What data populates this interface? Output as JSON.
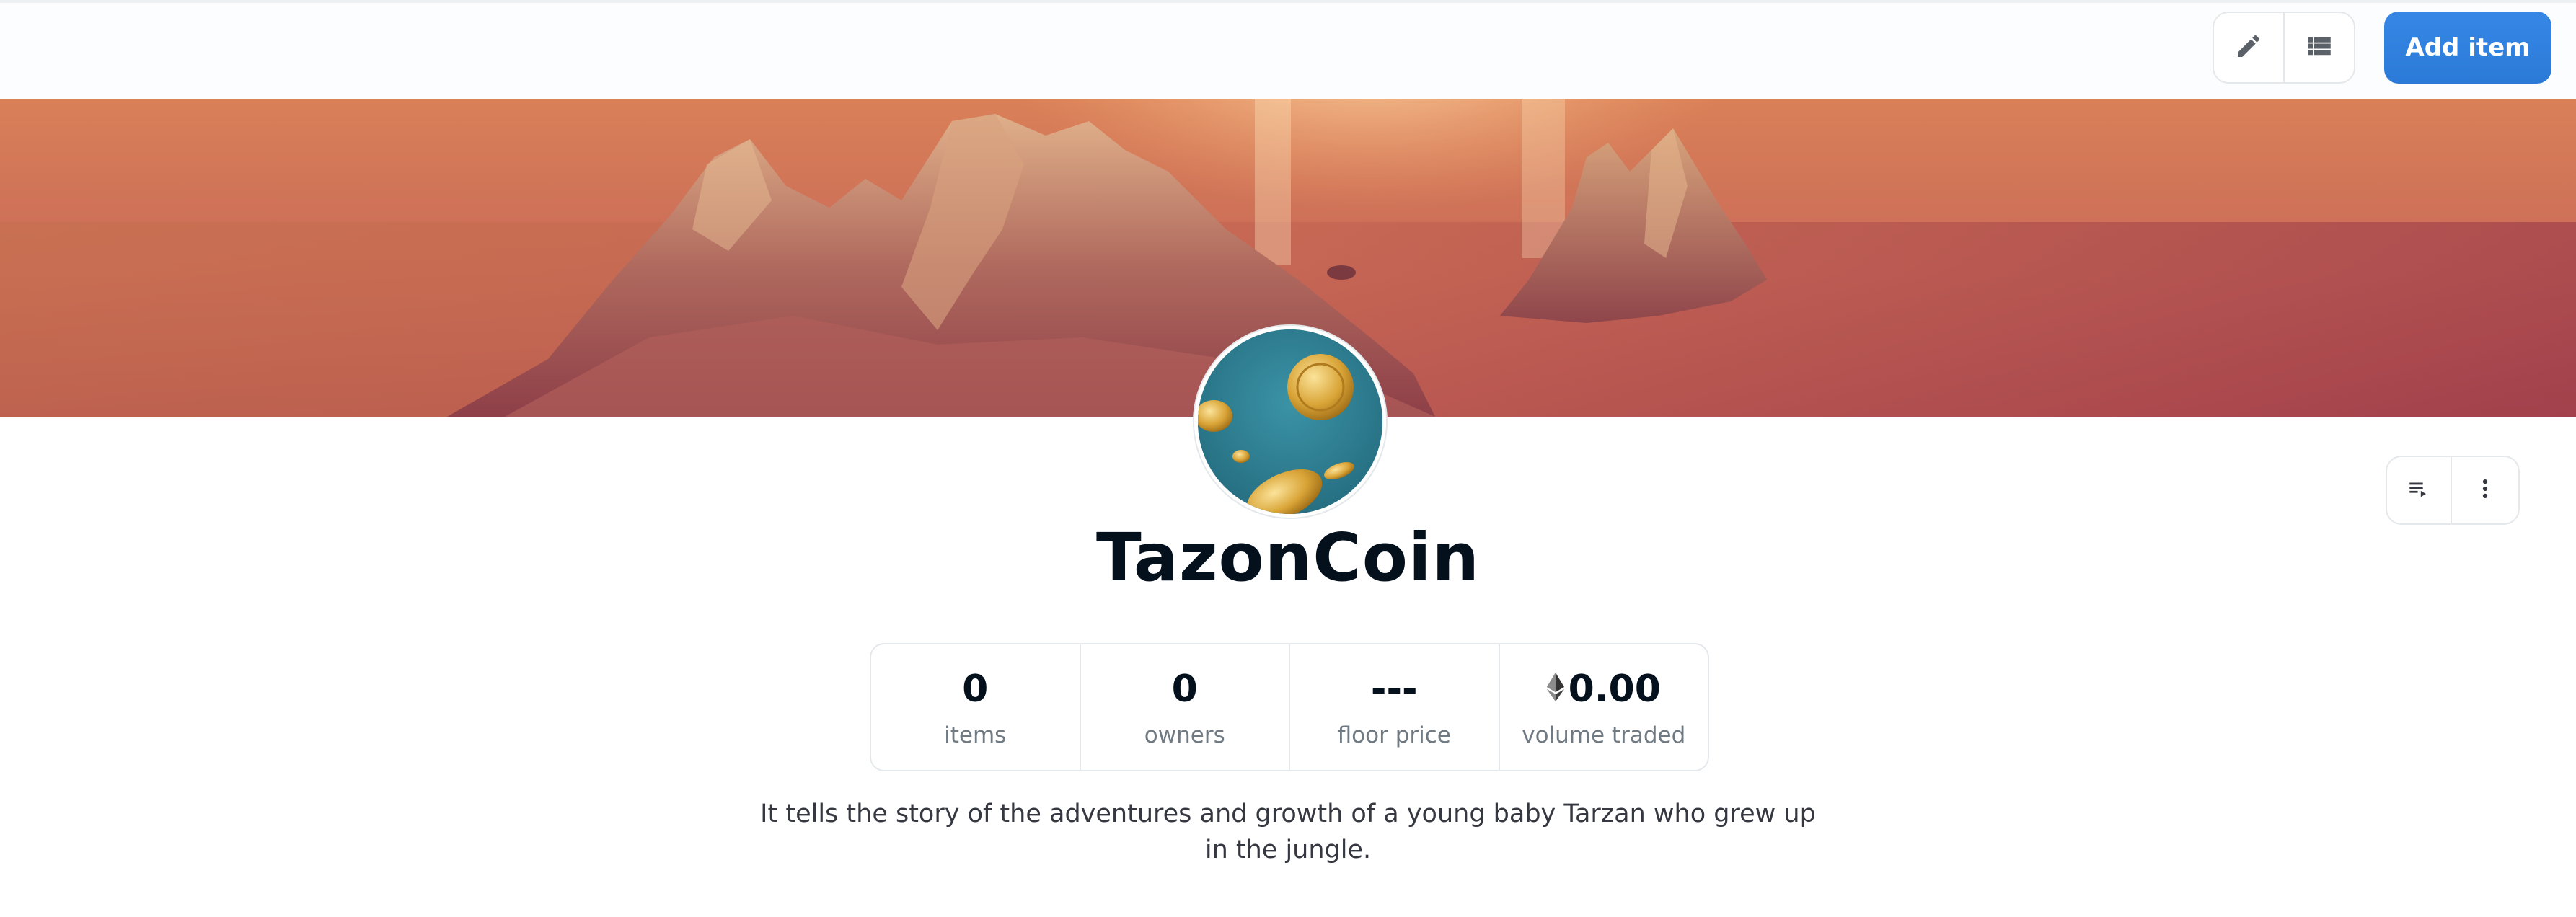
{
  "toolbar": {
    "edit_icon": "pencil-icon",
    "list_icon": "list-view-icon",
    "add_button_label": "Add item",
    "accent_color": "#2d80e0"
  },
  "collection": {
    "name": "TazonCoin",
    "description": "It tells the story of the adventures and growth of a young baby Tarzan who grew up in the jungle.",
    "actions": {
      "playlist_icon": "playlist-icon",
      "more_icon": "more-vertical-icon"
    }
  },
  "stats": [
    {
      "value": "0",
      "label": "items"
    },
    {
      "value": "0",
      "label": "owners"
    },
    {
      "value": "---",
      "label": "floor price"
    },
    {
      "value": "0.00",
      "label": "volume traded",
      "icon": "ethereum-icon"
    }
  ]
}
